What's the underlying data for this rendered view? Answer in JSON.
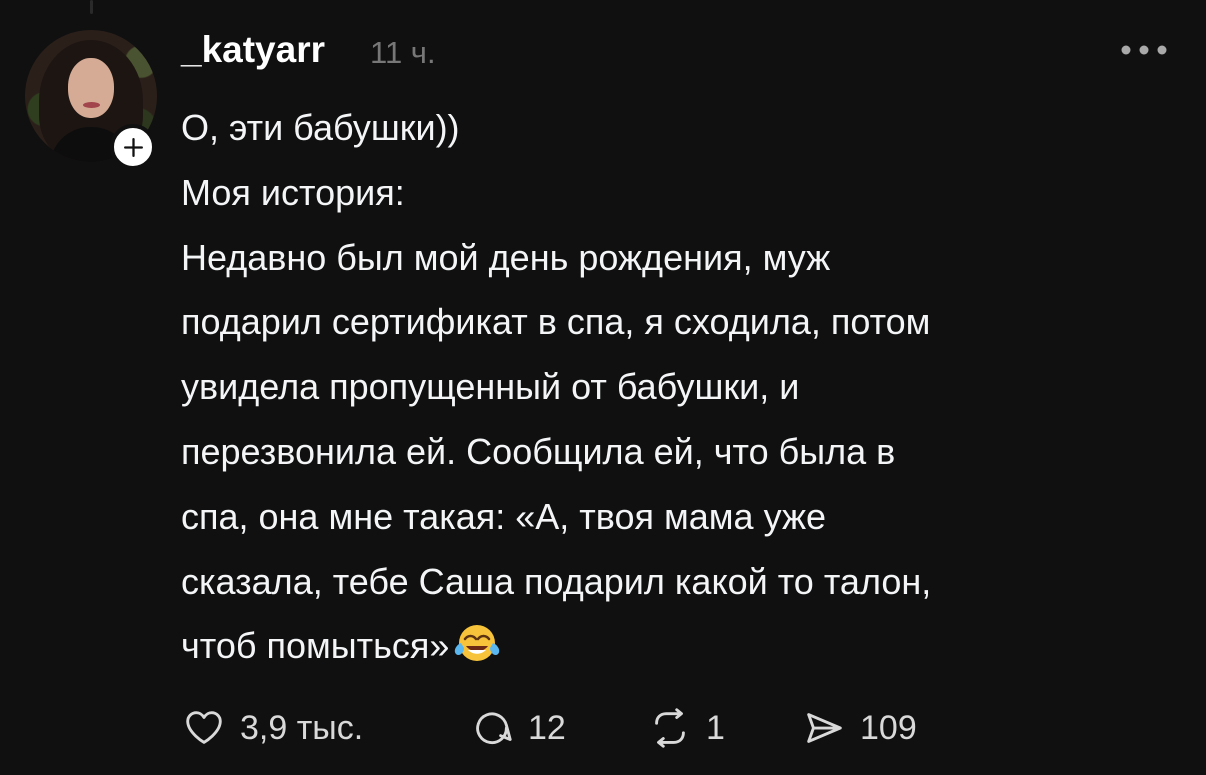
{
  "post": {
    "username": "_katyarr",
    "time": "11 ч.",
    "content": [
      "О, эти бабушки))",
      "Моя история:",
      "Недавно был мой день рождения, муж",
      "подарил сертификат в спа, я сходила, потом",
      "увидела пропущенный от бабушки, и",
      "перезвонила ей. Сообщила ей, что была в",
      "спа, она мне такая: «А, твоя мама уже",
      "сказала, тебе Саша подарил какой то талон,",
      "чтоб помыться»"
    ],
    "emoji": "tears-of-joy-emoji",
    "actions": {
      "likes": "3,9 тыс.",
      "replies": "12",
      "reposts": "1",
      "shares": "109"
    },
    "colors": {
      "background": "#101010",
      "text": "#f3f5f7",
      "secondary": "#777777",
      "icon": "#d9d9d9"
    }
  }
}
